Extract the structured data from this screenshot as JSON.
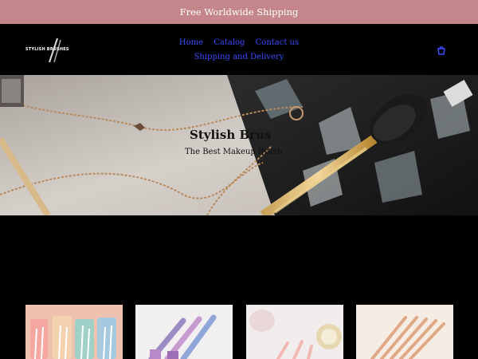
{
  "announcement": {
    "text": "Free Worldwide Shipping"
  },
  "header": {
    "logo_text": "STYLISH BRUSHES",
    "nav": [
      {
        "label": "Home"
      },
      {
        "label": "Catalog"
      },
      {
        "label": "Contact us"
      },
      {
        "label": "Shipping and Delivery"
      }
    ],
    "cart_icon": "cart-icon"
  },
  "hero": {
    "title": "Stylish Brus",
    "subtitle": "The Best Makeup Brush"
  },
  "products": [
    {
      "name": "product-1",
      "bg": "#e9b9a6"
    },
    {
      "name": "product-2",
      "bg": "#f1eef0"
    },
    {
      "name": "product-3",
      "bg": "#f0eaea"
    },
    {
      "name": "product-4",
      "bg": "#f3e6dc"
    }
  ],
  "colors": {
    "announcement_bg": "#c4868b",
    "nav_link": "#3b4bff",
    "page_bg": "#000000"
  }
}
